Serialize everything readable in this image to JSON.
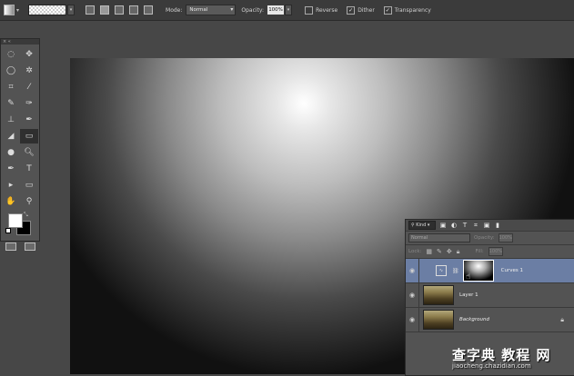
{
  "options_bar": {
    "mode_label": "Mode:",
    "mode_value": "Normal",
    "opacity_label": "Opacity:",
    "opacity_value": "100%",
    "reverse_label": "Reverse",
    "dither_label": "Dither",
    "transparency_label": "Transparency",
    "reverse_checked": false,
    "dither_checked": true,
    "transparency_checked": true
  },
  "layers_panel": {
    "kind_label": "Kind",
    "blend_mode": "Normal",
    "opacity_label": "Opacity:",
    "opacity_value": "100%",
    "lock_label": "Lock:",
    "fill_label": "Fill:",
    "fill_value": "100%",
    "layers": [
      {
        "name": "Curves 1",
        "active": true
      },
      {
        "name": "Layer 1",
        "active": false
      },
      {
        "name": "Background",
        "active": false
      }
    ]
  },
  "watermark": {
    "big": "查字典 教程 网",
    "url": "jiaocheng.chazidian.com"
  }
}
